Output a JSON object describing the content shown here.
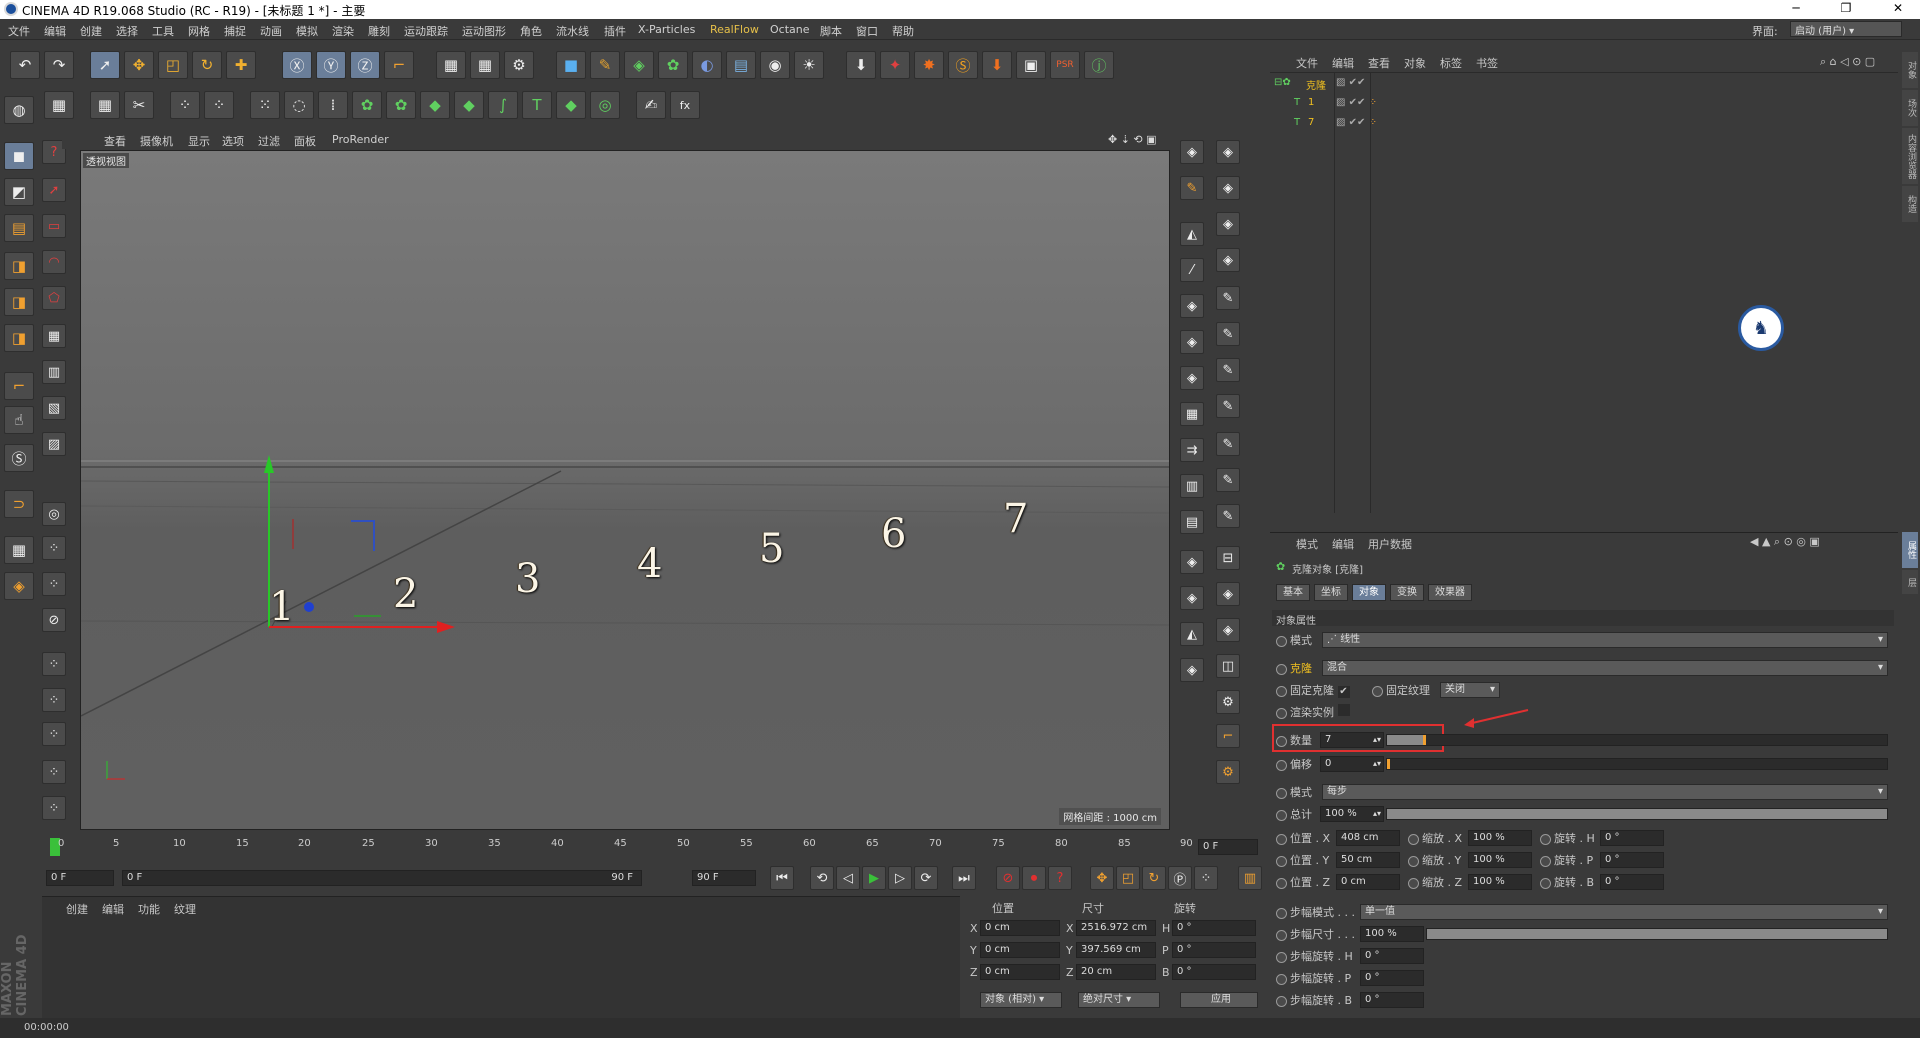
{
  "window": {
    "title": "CINEMA 4D R19.068 Studio (RC - R19) - [未标题 1 *] - 主要"
  },
  "menu": {
    "items": [
      "文件",
      "编辑",
      "创建",
      "选择",
      "工具",
      "网格",
      "捕捉",
      "动画",
      "模拟",
      "渲染",
      "雕刻",
      "运动跟踪",
      "运动图形",
      "角色",
      "流水线",
      "插件",
      "X-Particles",
      "RealFlow",
      "Octane",
      "脚本",
      "窗口",
      "帮助"
    ],
    "interface_label": "界面:",
    "interface_value": "启动 (用户)"
  },
  "viewport": {
    "menu": [
      "查看",
      "摄像机",
      "显示",
      "选项",
      "过滤",
      "面板",
      "ProRender"
    ],
    "label": "透视视图",
    "grid_distance": "网格间距 : 1000 cm",
    "clone_numbers": [
      "1",
      "2",
      "3",
      "4",
      "5",
      "6",
      "7"
    ]
  },
  "object_manager": {
    "menu": [
      "文件",
      "编辑",
      "查看",
      "对象",
      "标签",
      "书签"
    ],
    "objects": [
      {
        "name": "克隆"
      },
      {
        "name": "1"
      },
      {
        "name": "7"
      }
    ]
  },
  "attributes": {
    "menu": [
      "模式",
      "编辑",
      "用户数据"
    ],
    "title": "克隆对象 [克隆]",
    "tabs": [
      "基本",
      "坐标",
      "对象",
      "变换",
      "效果器"
    ],
    "active_tab": "对象",
    "section": "对象属性",
    "mode_label": "模式",
    "mode_value": "线性",
    "clone_label": "克隆",
    "clone_value": "混合",
    "fix_clone_label": "固定克隆",
    "fix_texture_label": "固定纹理",
    "fix_texture_value": "关闭",
    "render_instance_label": "渲染实例",
    "count_label": "数量",
    "count_value": "7",
    "offset_label": "偏移",
    "offset_value": "0",
    "mode2_label": "模式",
    "mode2_value": "每步",
    "total_label": "总计",
    "total_value": "100 %",
    "pos_x_label": "位置 . X",
    "pos_x": "408 cm",
    "pos_y_label": "位置 . Y",
    "pos_y": "50 cm",
    "pos_z_label": "位置 . Z",
    "pos_z": "0 cm",
    "scale_x_label": "缩放 . X",
    "scale_x": "100 %",
    "scale_y_label": "缩放 . Y",
    "scale_y": "100 %",
    "scale_z_label": "缩放 . Z",
    "scale_z": "100 %",
    "rot_h_label": "旋转 . H",
    "rot_h": "0 °",
    "rot_p_label": "旋转 . P",
    "rot_p": "0 °",
    "rot_b_label": "旋转 . B",
    "rot_b": "0 °",
    "step_mode_label": "步幅模式 . . .",
    "step_mode_value": "单一值",
    "step_size_label": "步幅尺寸 . . .",
    "step_size_value": "100 %",
    "step_rot_h_label": "步幅旋转 . H",
    "step_rot_h": "0 °",
    "step_rot_p_label": "步幅旋转 . P",
    "step_rot_p": "0 °",
    "step_rot_b_label": "步幅旋转 . B",
    "step_rot_b": "0 °"
  },
  "timeline": {
    "ticks": [
      "0",
      "5",
      "10",
      "15",
      "20",
      "25",
      "30",
      "35",
      "40",
      "45",
      "50",
      "55",
      "60",
      "65",
      "70",
      "75",
      "80",
      "85",
      "90"
    ],
    "current_frame": "0 F",
    "start_frame": "0 F",
    "range_start": "0 F",
    "range_end": "90 F",
    "end_frame": "90 F"
  },
  "material_manager": {
    "menu": [
      "创建",
      "编辑",
      "功能",
      "纹理"
    ]
  },
  "coordinates": {
    "headers": [
      "位置",
      "尺寸",
      "旋转"
    ],
    "x_pos": "0 cm",
    "y_pos": "0 cm",
    "z_pos": "0 cm",
    "x_size": "2516.972 cm",
    "y_size": "397.569 cm",
    "z_size": "20 cm",
    "h_rot": "0 °",
    "p_rot": "0 °",
    "b_rot": "0 °",
    "mode": "对象 (相对)",
    "size_mode": "绝对尺寸",
    "apply": "应用"
  },
  "status": {
    "time": "00:00:00"
  },
  "brand": {
    "line1": "MAXON",
    "line2": "CINEMA 4D"
  },
  "right_tabs": [
    "对象",
    "场次",
    "内容浏览器",
    "构造",
    "属性",
    "层"
  ],
  "colors": {
    "accent": "#6a7e99",
    "highlight_red": "#e03030",
    "realflow": "#e6c04a"
  }
}
